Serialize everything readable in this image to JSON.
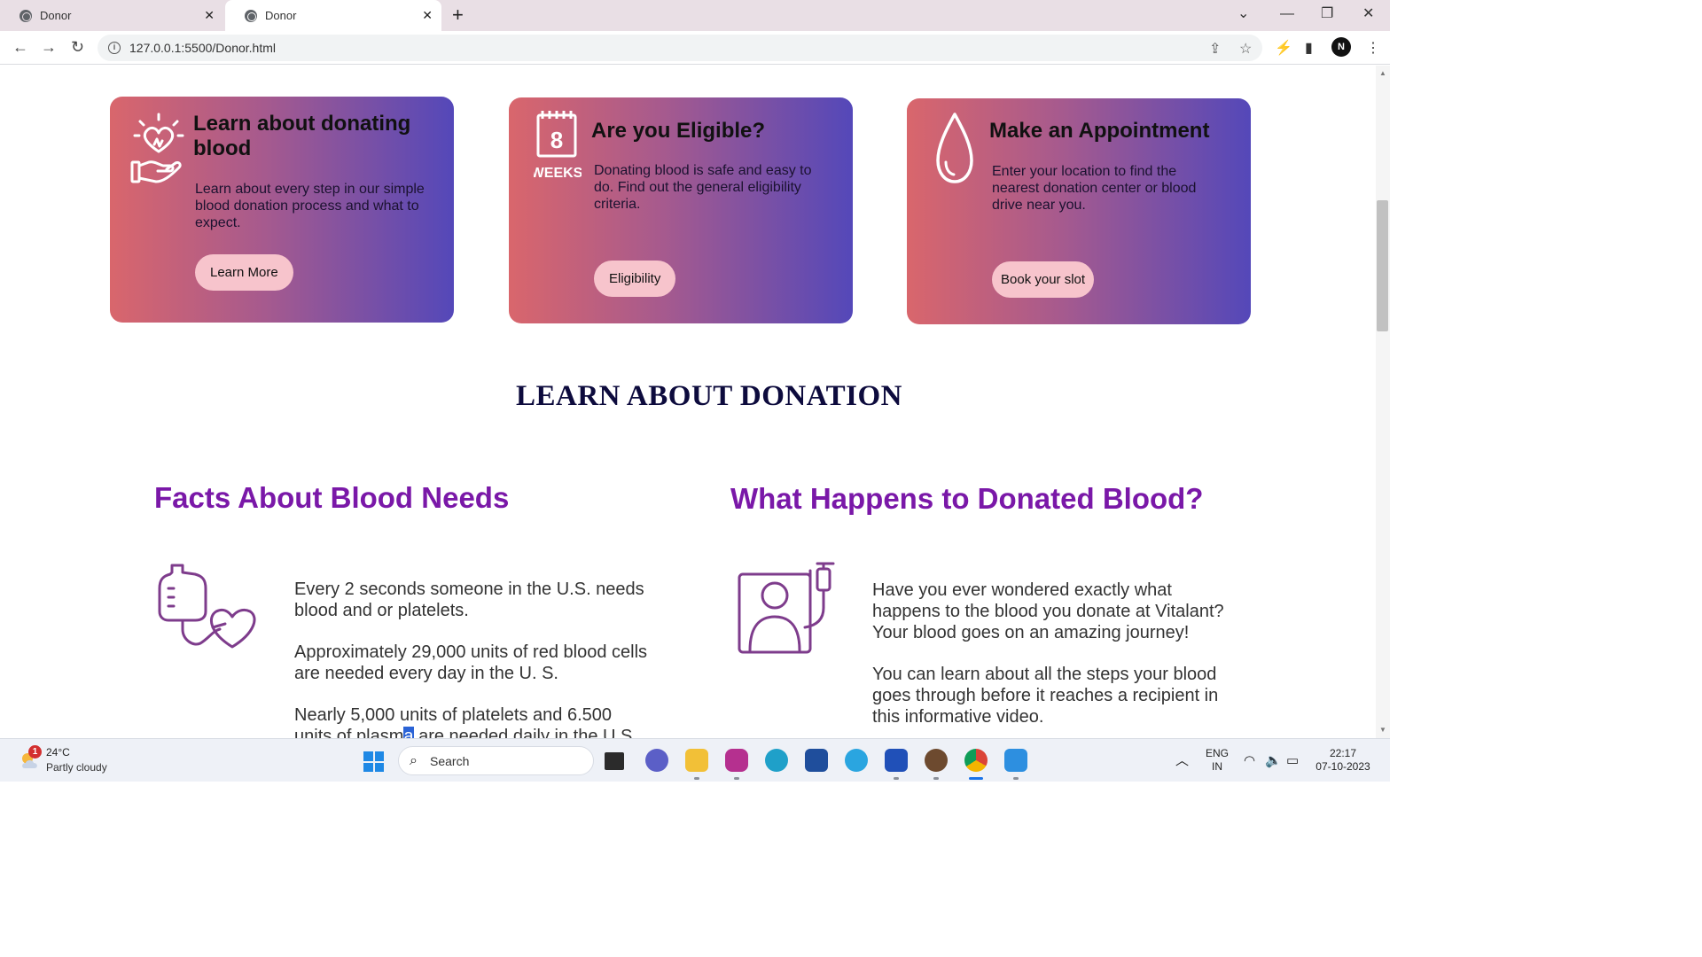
{
  "browser": {
    "tabs": [
      {
        "title": "Donor"
      },
      {
        "title": "Donor"
      }
    ],
    "url": "127.0.0.1:5500/Donor.html",
    "profile_initial": "N"
  },
  "cards": [
    {
      "title": "Learn about donating blood",
      "text": "Learn about every step in our simple blood donation process and what to expect.",
      "button": "Learn More",
      "icon": "heart-in-hand-icon"
    },
    {
      "title": "Are you Eligible?",
      "text": "Donating blood is safe and easy to do. Find out the general eligibility criteria.",
      "button": "Eligibility",
      "icon": "calendar-8-weeks-icon",
      "icon_number": "8",
      "icon_caption": "WEEKS"
    },
    {
      "title": "Make an Appointment",
      "text": "Enter your location to find the nearest donation center or blood drive near you.",
      "button": "Book your slot",
      "icon": "blood-drop-icon"
    }
  ],
  "section_heading": "LEARN ABOUT DONATION",
  "facts": {
    "title": "Facts About Blood Needs",
    "icon": "blood-bag-heart-icon",
    "paragraphs": [
      "Every 2 seconds someone in the U.S. needs blood and or platelets.",
      "Approximately 29,000 units of red blood cells are needed every day in the U. S.",
      "Nearly 5,000 units of platelets and 6.500"
    ],
    "last_line_start": "units of plasm",
    "last_line_selected": "a",
    "last_line_end": " are needed daily in the U.S."
  },
  "donated": {
    "title": "What Happens to Donated Blood?",
    "icon": "patient-transfusion-icon",
    "paragraphs": [
      "Have you ever wondered exactly what happens to the blood you donate at Vitalant? Your blood goes on an amazing journey!",
      "You can learn about all the steps your blood goes through before it reaches a recipient in this informative video."
    ]
  },
  "taskbar": {
    "weather_badge": "1",
    "temperature": "24°C",
    "weather": "Partly cloudy",
    "search_placeholder": "Search",
    "lang_top": "ENG",
    "lang_bottom": "IN",
    "time": "22:17",
    "date": "07-10-2023"
  }
}
